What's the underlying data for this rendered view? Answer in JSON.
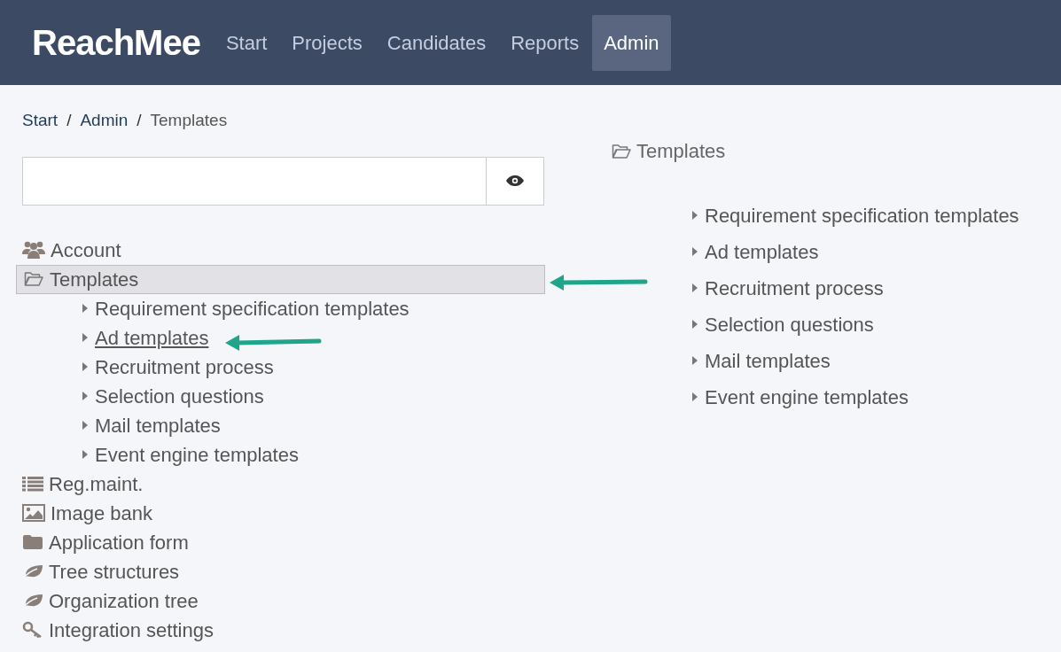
{
  "header": {
    "logo": "ReachMee",
    "nav": [
      {
        "label": "Start",
        "selected": false
      },
      {
        "label": "Projects",
        "selected": false
      },
      {
        "label": "Candidates",
        "selected": false
      },
      {
        "label": "Reports",
        "selected": false
      },
      {
        "label": "Admin",
        "selected": true
      }
    ]
  },
  "breadcrumb": [
    {
      "label": "Start",
      "link": true
    },
    {
      "label": "Admin",
      "link": true
    },
    {
      "label": "Templates",
      "link": false
    }
  ],
  "breadcrumb_separator": "/",
  "sidebar": {
    "items": [
      {
        "label": "Account",
        "selected": false
      },
      {
        "label": "Templates",
        "selected": true,
        "children": [
          {
            "label": "Requirement specification templates",
            "hovered": false
          },
          {
            "label": "Ad templates",
            "hovered": true
          },
          {
            "label": "Recruitment process",
            "hovered": false
          },
          {
            "label": "Selection questions",
            "hovered": false
          },
          {
            "label": "Mail templates",
            "hovered": false
          },
          {
            "label": "Event engine templates",
            "hovered": false
          }
        ]
      },
      {
        "label": "Reg.maint.",
        "selected": false
      },
      {
        "label": "Image bank",
        "selected": false
      },
      {
        "label": "Application form",
        "selected": false
      },
      {
        "label": "Tree structures",
        "selected": false
      },
      {
        "label": "Organization tree",
        "selected": false
      },
      {
        "label": "Integration settings",
        "selected": false
      }
    ]
  },
  "detail": {
    "title": "Templates",
    "items": [
      {
        "label": "Requirement specification templates"
      },
      {
        "label": "Ad templates"
      },
      {
        "label": "Recruitment process"
      },
      {
        "label": "Selection questions"
      },
      {
        "label": "Mail templates"
      },
      {
        "label": "Event engine templates"
      }
    ]
  }
}
